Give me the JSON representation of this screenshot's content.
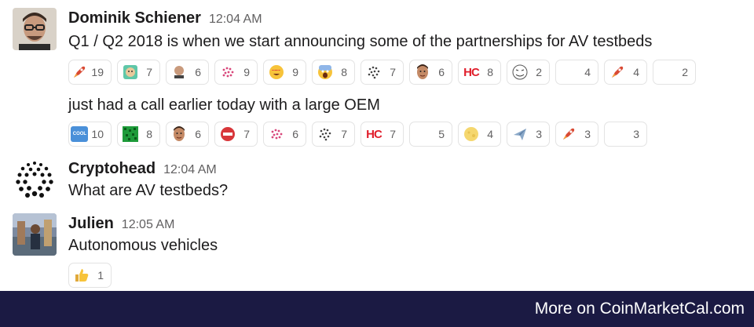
{
  "messages": [
    {
      "author": "Dominik Schiener",
      "time": "12:04 AM",
      "lines": [
        "Q1 / Q2 2018 is when we start announcing some of the partnerships for AV testbeds",
        "just had a call earlier today with a large OEM"
      ]
    },
    {
      "author": "Cryptohead",
      "time": "12:04 AM",
      "lines": [
        "What are AV testbeds?"
      ]
    },
    {
      "author": "Julien",
      "time": "12:05 AM",
      "lines": [
        "Autonomous vehicles"
      ]
    }
  ],
  "reactions_row1": [
    {
      "icon": "rocket-icon",
      "count": "19"
    },
    {
      "icon": "custom-emoji-icon",
      "count": "7"
    },
    {
      "icon": "custom-face-icon",
      "count": "6"
    },
    {
      "icon": "iota-pink-icon",
      "count": "9"
    },
    {
      "icon": "heart-eyes-icon",
      "count": "9"
    },
    {
      "icon": "scream-icon",
      "count": "8"
    },
    {
      "icon": "iota-logo-icon",
      "count": "7"
    },
    {
      "icon": "face-icon",
      "count": "6"
    },
    {
      "icon": "hc-icon",
      "count": "8",
      "glyph": "HC"
    },
    {
      "icon": "rage-face-icon",
      "count": "2"
    },
    {
      "icon": "blank-emoji-icon",
      "count": "4"
    },
    {
      "icon": "rocket-icon",
      "count": "4"
    },
    {
      "icon": "blank-emoji-icon",
      "count": "2"
    }
  ],
  "reactions_row2": [
    {
      "icon": "cool-icon",
      "count": "10",
      "glyph": "COOL"
    },
    {
      "icon": "green-pattern-icon",
      "count": "8"
    },
    {
      "icon": "face-icon",
      "count": "6"
    },
    {
      "icon": "red-badge-icon",
      "count": "7"
    },
    {
      "icon": "iota-pink-icon",
      "count": "6"
    },
    {
      "icon": "iota-logo-icon",
      "count": "7"
    },
    {
      "icon": "hc-icon",
      "count": "7",
      "glyph": "HC"
    },
    {
      "icon": "blank-emoji-icon",
      "count": "5"
    },
    {
      "icon": "full-moon-icon",
      "count": "4"
    },
    {
      "icon": "airplane-icon",
      "count": "3"
    },
    {
      "icon": "rocket-icon",
      "count": "3"
    },
    {
      "icon": "blank-emoji-icon",
      "count": "3"
    }
  ],
  "reactions_row3": [
    {
      "icon": "thumbs-up-icon",
      "count": "1"
    }
  ],
  "footer": {
    "text": "More on CoinMarketCal.com"
  },
  "colors": {
    "footer_bg": "#1b1a43",
    "hc_red": "#e01e2b",
    "rocket_red": "#e05a3a"
  }
}
